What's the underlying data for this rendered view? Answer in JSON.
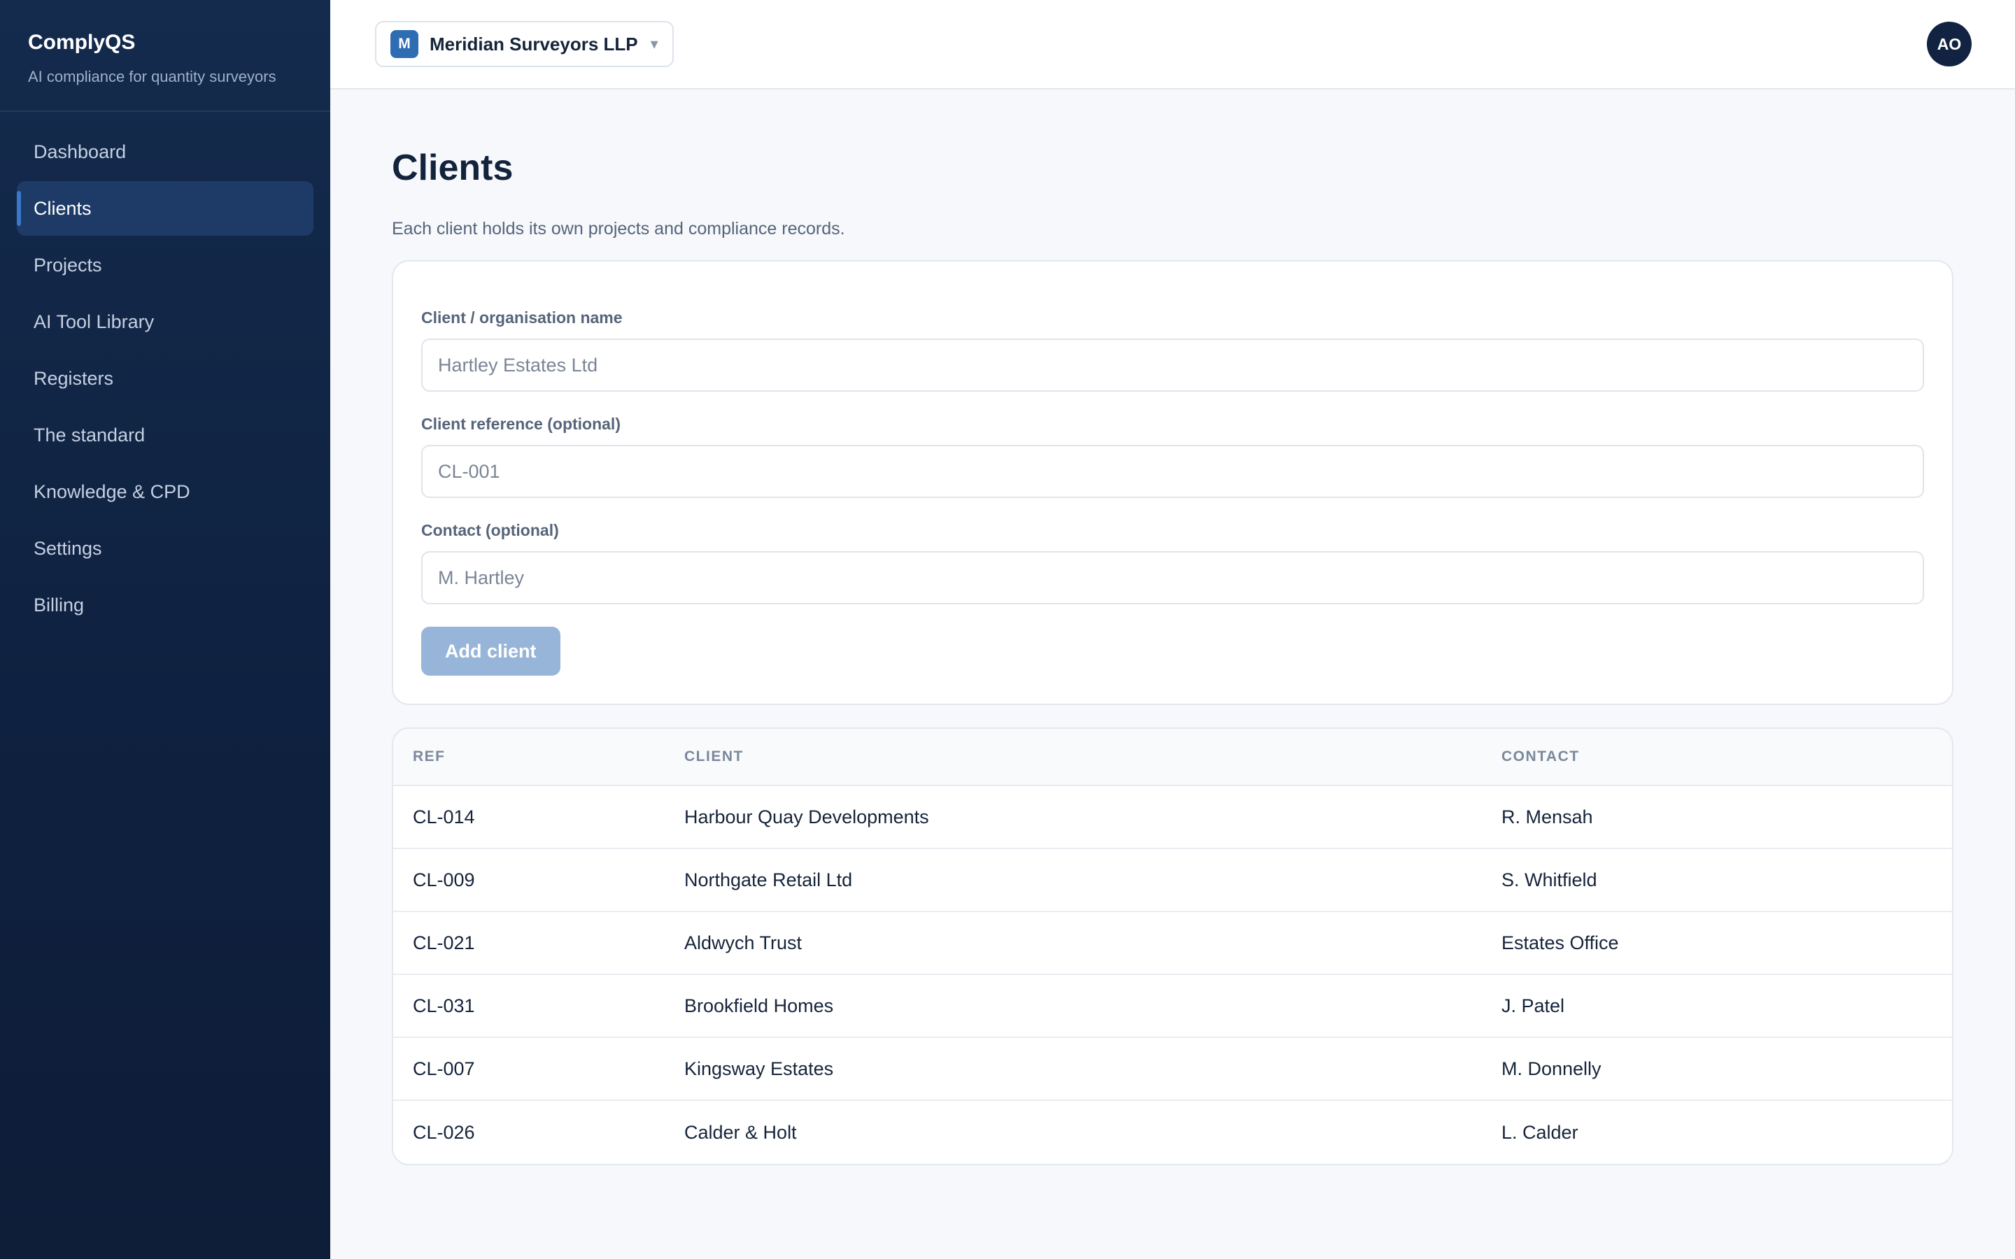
{
  "sidebar": {
    "brand_name": "ComplyQS",
    "brand_tagline": "AI compliance for quantity surveyors",
    "items": [
      {
        "label": "Dashboard"
      },
      {
        "label": "Clients"
      },
      {
        "label": "Projects"
      },
      {
        "label": "AI Tool Library"
      },
      {
        "label": "Registers"
      },
      {
        "label": "The standard"
      },
      {
        "label": "Knowledge & CPD"
      },
      {
        "label": "Settings"
      },
      {
        "label": "Billing"
      }
    ],
    "active_item": "Clients"
  },
  "topbar": {
    "org_initial": "M",
    "org_name": "Meridian Surveyors LLP",
    "org_chevron": "▾",
    "user_initials": "AO"
  },
  "page": {
    "title": "Clients",
    "description": "Each client holds its own projects and compliance records."
  },
  "form": {
    "name_label": "Client / organisation name",
    "name_placeholder": "Hartley Estates Ltd",
    "name_value": "",
    "ref_label": "Client reference (optional)",
    "ref_placeholder": "CL-001",
    "ref_value": "",
    "contact_label": "Contact (optional)",
    "contact_placeholder": "M. Hartley",
    "contact_value": "",
    "submit_label": "Add client"
  },
  "table": {
    "columns": [
      "REF",
      "CLIENT",
      "CONTACT"
    ],
    "rows": [
      {
        "ref": "CL-014",
        "client": "Harbour Quay Developments",
        "contact": "R. Mensah"
      },
      {
        "ref": "CL-009",
        "client": "Northgate Retail Ltd",
        "contact": "S. Whitfield"
      },
      {
        "ref": "CL-021",
        "client": "Aldwych Trust",
        "contact": "Estates Office"
      },
      {
        "ref": "CL-031",
        "client": "Brookfield Homes",
        "contact": "J. Patel"
      },
      {
        "ref": "CL-007",
        "client": "Kingsway Estates",
        "contact": "M. Donnelly"
      },
      {
        "ref": "CL-026",
        "client": "Calder & Holt",
        "contact": "L. Calder"
      }
    ]
  },
  "colors": {
    "sidebar_bg": "#0f2140",
    "accent": "#2f6db3",
    "active_indicator": "#3b78c9",
    "button_disabled": "#97b5d8"
  },
  "icons": {
    "org_switcher_chevron": "chevron-down-icon"
  }
}
